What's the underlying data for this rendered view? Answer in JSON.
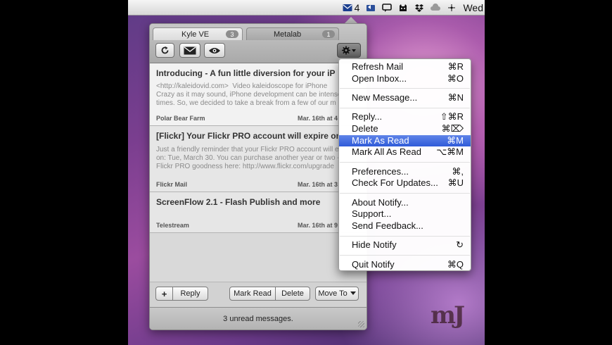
{
  "menubar": {
    "mail_count": "4",
    "clock": "Wed"
  },
  "tabs": [
    {
      "label": "Kyle VE",
      "badge": "3"
    },
    {
      "label": "Metalab",
      "badge": "1"
    }
  ],
  "toolbar": {
    "refresh_icon": "refresh-icon",
    "compose_icon": "envelope-icon",
    "preview_icon": "eye-icon",
    "gear_icon": "gear-icon"
  },
  "mails": [
    {
      "subject": "Introducing - A fun little diversion for your iP",
      "preview": "<http://kaleidovid.com>  Video kaleidoscope for iPhone\nCrazy as it may sound, iPhone development can be intense\ntimes. So, we decided to take a break from a few of our m",
      "from": "Polar Bear Farm",
      "date": "Mar. 16th at 4"
    },
    {
      "subject": "[Flickr] Your Flickr PRO account will expire on",
      "preview": "Just a friendly reminder that your Flickr PRO account will e\non: Tue, March 30. You can purchase another year or two -\nFlickr PRO goodness here: http://www.flickr.com/upgrade",
      "from": "Flickr Mail",
      "date": "Mar. 16th at 3"
    },
    {
      "subject": "ScreenFlow 2.1 - Flash Publish and more",
      "preview": "",
      "from": "Telestream",
      "date": "Mar. 16th at 9"
    }
  ],
  "buttons": {
    "add": "+",
    "reply": "Reply",
    "mark_read": "Mark Read",
    "delete": "Delete",
    "move_to": "Move To"
  },
  "status": "3 unread messages.",
  "menu": [
    [
      {
        "label": "Refresh Mail",
        "shortcut": "⌘R"
      },
      {
        "label": "Open Inbox...",
        "shortcut": "⌘O"
      }
    ],
    [
      {
        "label": "New Message...",
        "shortcut": "⌘N"
      }
    ],
    [
      {
        "label": "Reply...",
        "shortcut": "⇧⌘R"
      },
      {
        "label": "Delete",
        "shortcut": "⌘⌦"
      },
      {
        "label": "Mark As Read",
        "shortcut": "⌘M",
        "selected": true
      },
      {
        "label": "Mark All As Read",
        "shortcut": "⌥⌘M"
      }
    ],
    [
      {
        "label": "Preferences...",
        "shortcut": "⌘,"
      },
      {
        "label": "Check For Updates...",
        "shortcut": "⌘U"
      }
    ],
    [
      {
        "label": "About Notify...",
        "shortcut": ""
      },
      {
        "label": "Support...",
        "shortcut": ""
      },
      {
        "label": "Send Feedback...",
        "shortcut": ""
      }
    ],
    [
      {
        "label": "Hide Notify",
        "shortcut": "↻"
      }
    ],
    [
      {
        "label": "Quit Notify",
        "shortcut": "⌘Q"
      }
    ]
  ],
  "watermark": "mJ"
}
